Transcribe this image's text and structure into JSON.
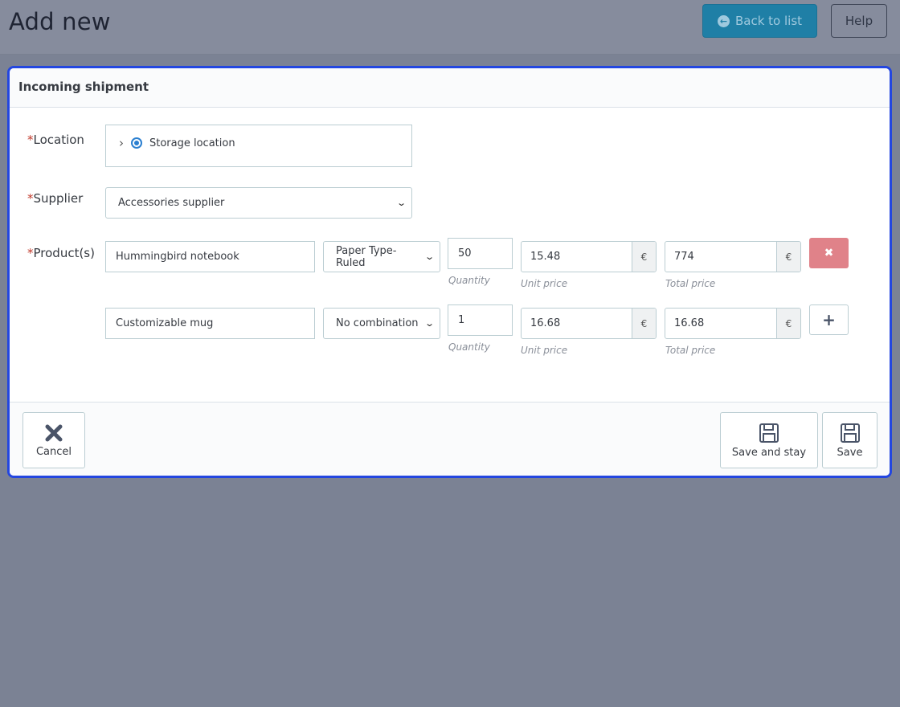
{
  "header": {
    "title": "Add new",
    "back_label": "Back to list",
    "help_label": "Help"
  },
  "panel": {
    "title": "Incoming shipment"
  },
  "form": {
    "location": {
      "label": "Location",
      "required_mark": "*",
      "tree_item": "Storage location"
    },
    "supplier": {
      "label": "Supplier",
      "required_mark": "*",
      "value": "Accessories supplier"
    },
    "products": {
      "label": "Product(s)",
      "required_mark": "*",
      "currency": "€",
      "quantity_hint": "Quantity",
      "unit_price_hint": "Unit price",
      "total_price_hint": "Total price",
      "rows": [
        {
          "name": "Hummingbird notebook",
          "combination": "Paper Type-Ruled",
          "quantity": "50",
          "unit_price": "15.48",
          "total_price": "774"
        },
        {
          "name": "Customizable mug",
          "combination": "No combination",
          "quantity": "1",
          "unit_price": "16.68",
          "total_price": "16.68"
        }
      ]
    }
  },
  "footer": {
    "cancel_label": "Cancel",
    "save_stay_label": "Save and stay",
    "save_label": "Save"
  }
}
